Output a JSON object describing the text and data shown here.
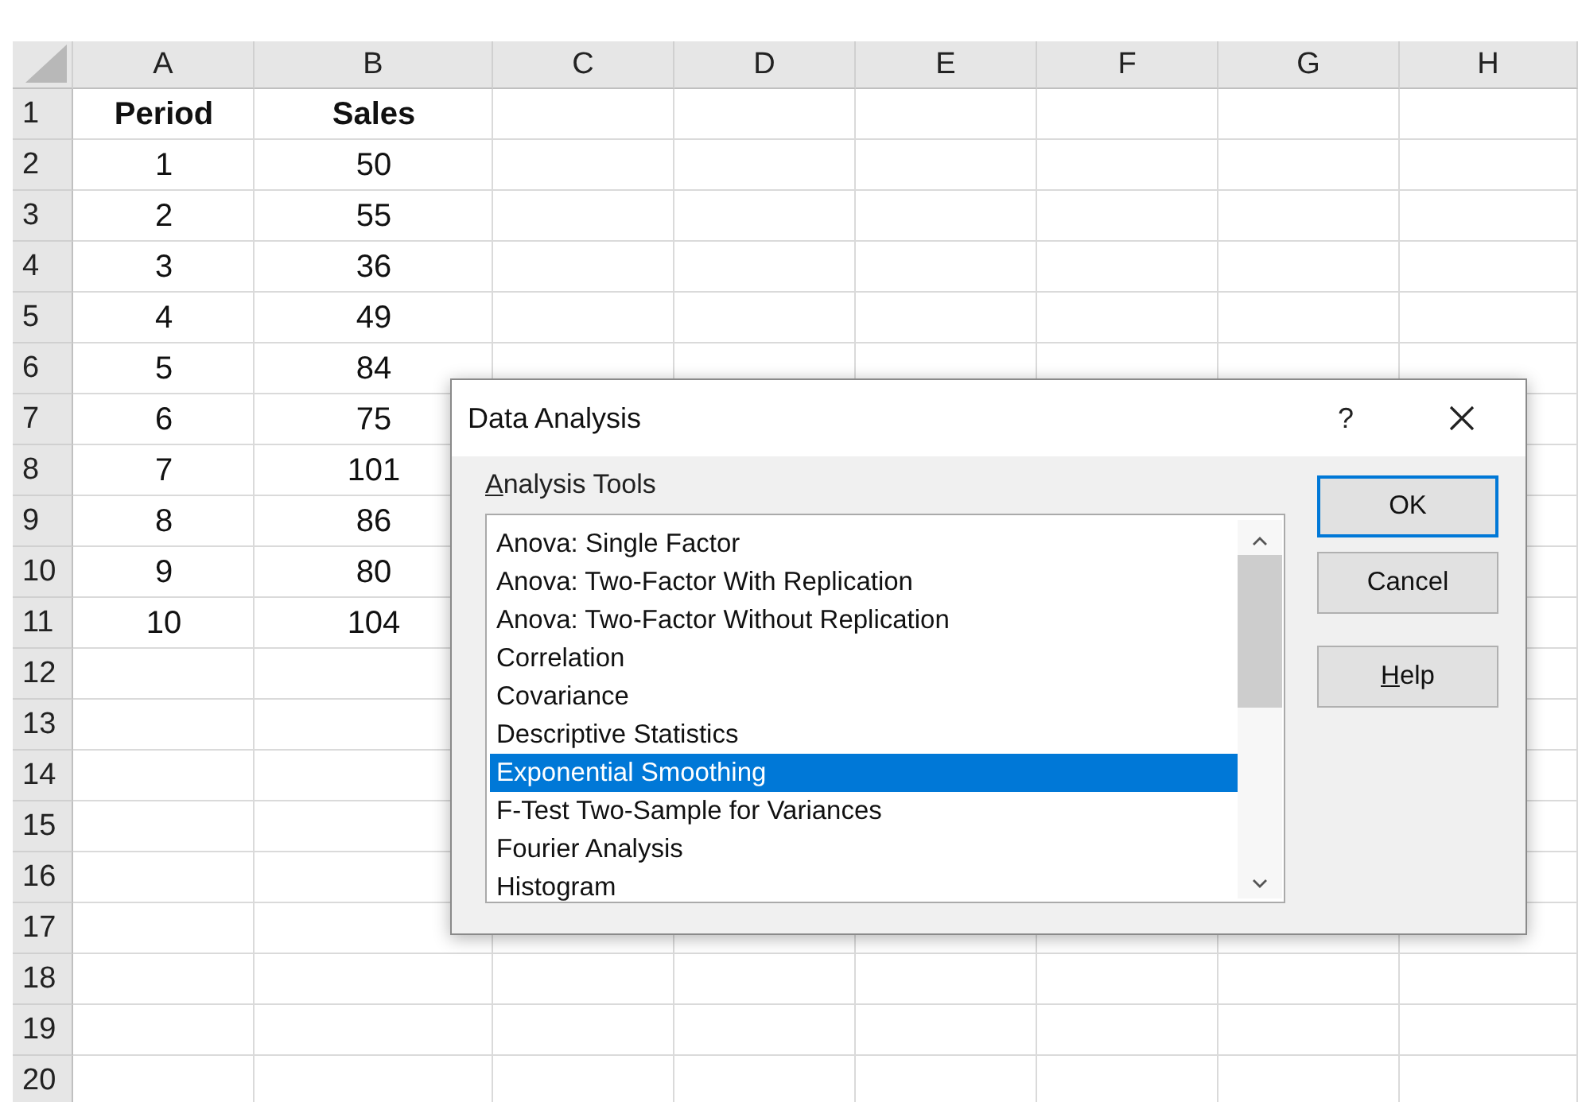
{
  "sheet": {
    "columns": [
      "A",
      "B",
      "C",
      "D",
      "E",
      "F",
      "G",
      "H"
    ],
    "rows": [
      {
        "number": "1",
        "kind": "header",
        "cells": [
          "Period",
          "Sales"
        ]
      },
      {
        "number": "2",
        "kind": "data",
        "cells": [
          "1",
          "50"
        ]
      },
      {
        "number": "3",
        "kind": "data",
        "cells": [
          "2",
          "55"
        ]
      },
      {
        "number": "4",
        "kind": "data",
        "cells": [
          "3",
          "36"
        ]
      },
      {
        "number": "5",
        "kind": "data",
        "cells": [
          "4",
          "49"
        ]
      },
      {
        "number": "6",
        "kind": "data",
        "cells": [
          "5",
          "84"
        ]
      },
      {
        "number": "7",
        "kind": "data",
        "cells": [
          "6",
          "75"
        ]
      },
      {
        "number": "8",
        "kind": "data",
        "cells": [
          "7",
          "101"
        ]
      },
      {
        "number": "9",
        "kind": "data",
        "cells": [
          "8",
          "86"
        ]
      },
      {
        "number": "10",
        "kind": "data",
        "cells": [
          "9",
          "80"
        ]
      },
      {
        "number": "11",
        "kind": "data",
        "cells": [
          "10",
          "104"
        ]
      },
      {
        "number": "12",
        "cells": []
      },
      {
        "number": "13",
        "cells": []
      },
      {
        "number": "14",
        "cells": []
      },
      {
        "number": "15",
        "cells": []
      },
      {
        "number": "16",
        "cells": []
      },
      {
        "number": "17",
        "cells": []
      },
      {
        "number": "18",
        "cells": []
      },
      {
        "number": "19",
        "cells": []
      },
      {
        "number": "20",
        "cells": []
      }
    ]
  },
  "dialog": {
    "title": "Data Analysis",
    "help_glyph": "?",
    "list_label": {
      "text": "Analysis Tools",
      "first_letter_underlined": true
    },
    "items": [
      {
        "label": "Anova: Single Factor",
        "selected": false
      },
      {
        "label": "Anova: Two-Factor With Replication",
        "selected": false
      },
      {
        "label": "Anova: Two-Factor Without Replication",
        "selected": false
      },
      {
        "label": "Correlation",
        "selected": false
      },
      {
        "label": "Covariance",
        "selected": false
      },
      {
        "label": "Descriptive Statistics",
        "selected": false
      },
      {
        "label": "Exponential Smoothing",
        "selected": true
      },
      {
        "label": "F-Test Two-Sample for Variances",
        "selected": false
      },
      {
        "label": "Fourier Analysis",
        "selected": false
      },
      {
        "label": "Histogram",
        "selected": false
      }
    ],
    "buttons": [
      {
        "label": "OK",
        "default": true
      },
      {
        "label": "Cancel",
        "default": false
      },
      {
        "label": "Help",
        "default": false,
        "first_letter_underlined": true
      }
    ]
  }
}
